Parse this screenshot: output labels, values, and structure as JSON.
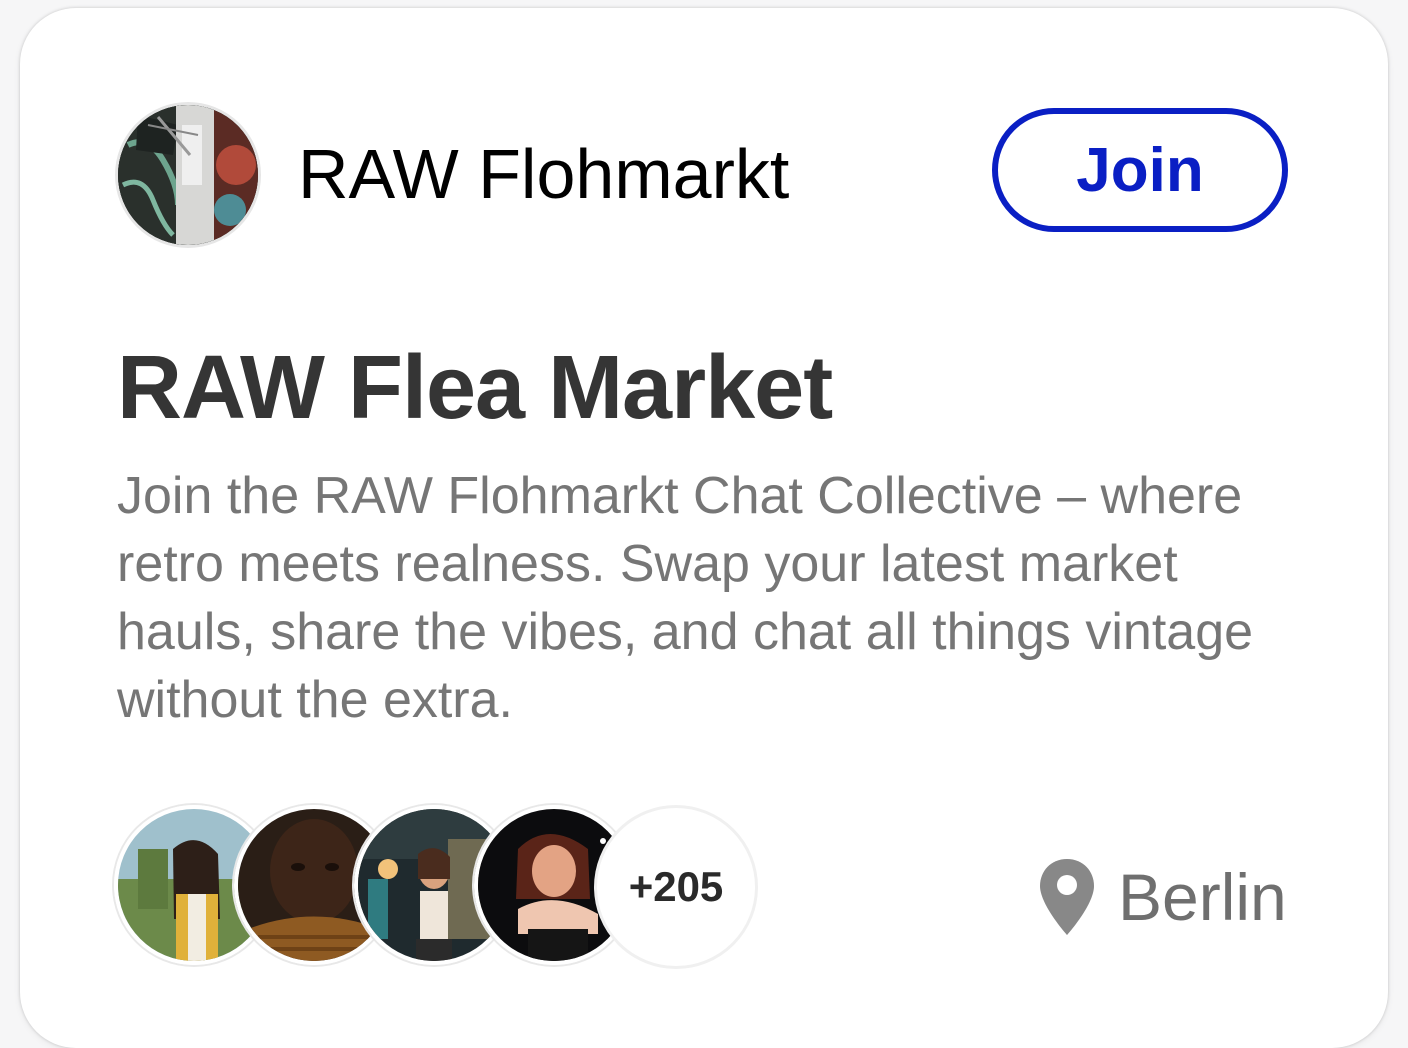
{
  "group": {
    "name": "RAW Flohmarkt",
    "avatar_icon": "group-avatar-graffiti"
  },
  "actions": {
    "join_label": "Join",
    "accent_color": "#0a1fc4"
  },
  "event": {
    "title": "RAW Flea Market",
    "description": "Join the RAW Flohmarkt Chat Collective – where retro meets realness. Swap your latest market hauls, share the vibes, and chat all things vintage without the extra."
  },
  "members": {
    "avatars": [
      "member-avatar-1",
      "member-avatar-2",
      "member-avatar-3",
      "member-avatar-4"
    ],
    "extra_count": "+205"
  },
  "location": {
    "icon": "location-pin-icon",
    "city": "Berlin"
  }
}
